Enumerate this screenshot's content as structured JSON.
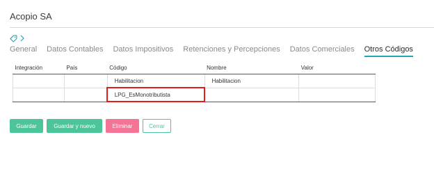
{
  "header": {
    "title": "Acopio SA"
  },
  "icons": {
    "tag": "tag-icon",
    "chevron": "chevron-right-icon"
  },
  "tabs": [
    {
      "label": "General",
      "active": false
    },
    {
      "label": "Datos Contables",
      "active": false
    },
    {
      "label": "Datos Impositivos",
      "active": false
    },
    {
      "label": "Retenciones y Percepciones",
      "active": false
    },
    {
      "label": "Datos Comerciales",
      "active": false
    },
    {
      "label": "Otros Códigos",
      "active": true
    }
  ],
  "grid": {
    "columns": [
      "Integración",
      "País",
      "Código",
      "Nombre",
      "Valor"
    ],
    "rows": [
      [
        "",
        "",
        "Habilitacion",
        "Habilitacion",
        ""
      ],
      [
        "",
        "",
        "LPG_EsMonotributista",
        "",
        ""
      ]
    ],
    "selected_cell": {
      "row": 1,
      "col": 2
    }
  },
  "actions": {
    "save": "Guardar",
    "save_new": "Guardar y nuevo",
    "delete": "Eliminar",
    "close": "Cerrar"
  },
  "colors": {
    "accent": "#22a6b3",
    "save": "#4cc59a",
    "delete": "#f37494",
    "selection": "#e21b1b"
  }
}
